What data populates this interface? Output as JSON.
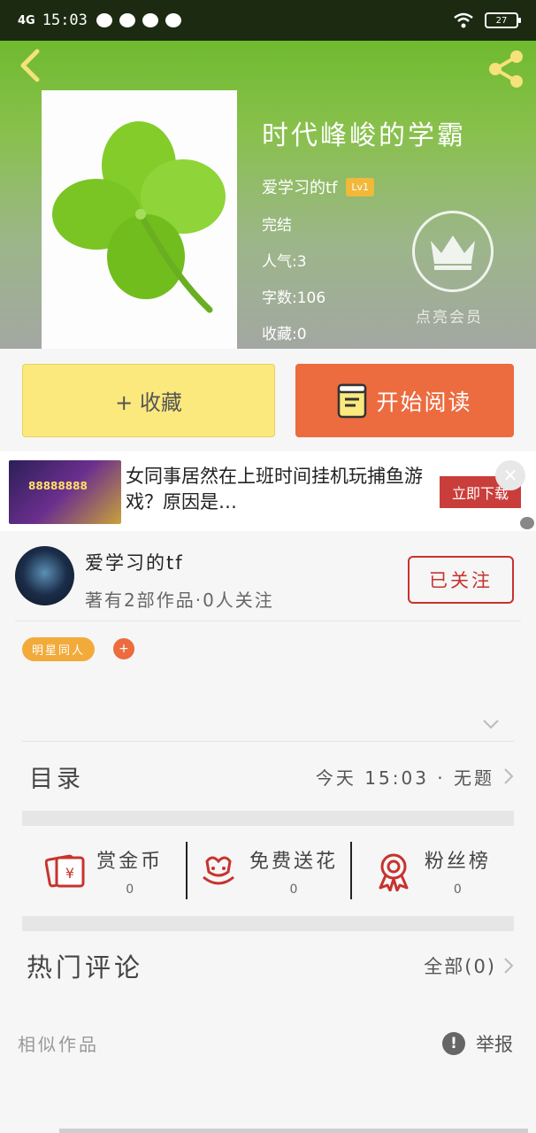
{
  "statusbar": {
    "network": "4G",
    "time": "15:03",
    "battery": "27"
  },
  "header": {
    "title": "时代峰峻的学霸",
    "author": "爱学习的tf",
    "level": "Lv1",
    "status": "完结",
    "popularity": "人气:3",
    "word_count": "字数:106",
    "favorites": "收藏:0",
    "vip_label": "点亮会员",
    "icons": {
      "back": "back-arrow-icon",
      "share": "share-icon",
      "crown": "crown-icon"
    },
    "colors": {
      "gradient_top": "#6fba2f",
      "gradient_bottom": "#a3a7a2"
    }
  },
  "actions": {
    "favorite_label": "+ 收藏",
    "read_label": "开始阅读",
    "colors": {
      "favorite_bg": "#fbe97d",
      "read_bg": "#ec6b3f"
    }
  },
  "ad": {
    "text": "女同事居然在上班时间挂机玩捕鱼游戏？原因是…",
    "download_label": "立即下载",
    "thumb_text": "88888888"
  },
  "author": {
    "name": "爱学习的tf",
    "meta": "著有2部作品·0人关注",
    "follow_label": "已关注",
    "tag": "明星同人",
    "tag_add": "+"
  },
  "catalog": {
    "label": "目录",
    "latest": "今天 15:03 · 无题"
  },
  "stats": [
    {
      "label": "赏金币",
      "count": "0",
      "icon": "red-envelope-icon"
    },
    {
      "label": "免费送花",
      "count": "0",
      "icon": "flower-icon"
    },
    {
      "label": "粉丝榜",
      "count": "0",
      "icon": "award-ribbon-icon"
    }
  ],
  "comments": {
    "label": "热门评论",
    "all_label": "全部(0)"
  },
  "footer": {
    "similar_label": "相似作品",
    "report_label": "举报"
  },
  "accent_red": "#c7332e"
}
